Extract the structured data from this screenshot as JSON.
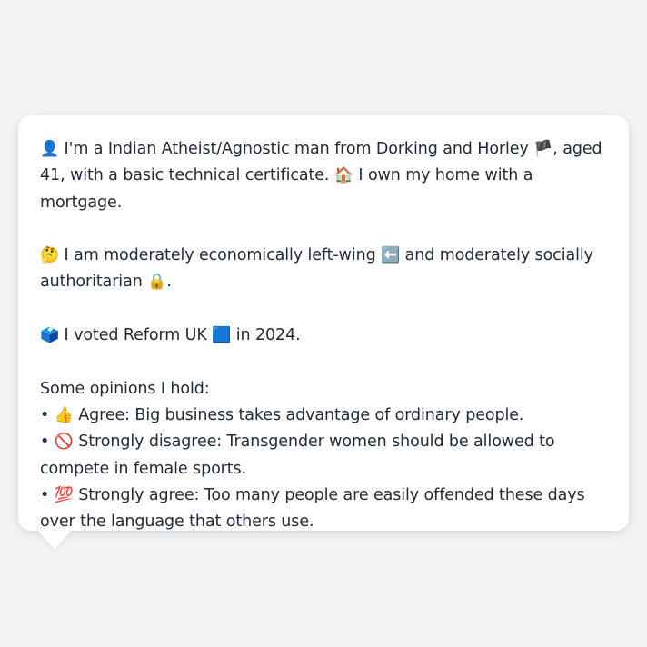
{
  "message": {
    "intro": {
      "icon": "👤",
      "text_a": "I'm a Indian Atheist/Agnostic man from Dorking and Horley",
      "flag": "🏴",
      "text_b": ", aged 41, with a basic technical certificate.",
      "home_icon": "🏠",
      "text_c": "I own my home with a mortgage."
    },
    "politics": {
      "icon": "🤔",
      "text_a": "I am moderately economically left-wing",
      "left_icon": "⬅️",
      "text_b": "and moderately socially authoritarian",
      "lock_icon": "🔒",
      "text_c": "."
    },
    "vote": {
      "icon": "🗳️",
      "text_a": "I voted Reform UK",
      "party_icon": "🟦",
      "text_b": "in 2024."
    },
    "opinions_heading": "Some opinions I hold:",
    "opinions": [
      {
        "bullet": "•",
        "icon": "👍",
        "text": "Agree: Big business takes advantage of ordinary people."
      },
      {
        "bullet": "•",
        "icon": "🚫",
        "text": "Strongly disagree: Transgender women should be allowed to compete in female sports."
      },
      {
        "bullet": "•",
        "icon": "💯",
        "text": "Strongly agree: Too many people are easily offended these days over the language that others use."
      }
    ]
  },
  "colors": {
    "background": "#f3f4f6",
    "bubble": "#ffffff",
    "text": "#1f2937"
  }
}
